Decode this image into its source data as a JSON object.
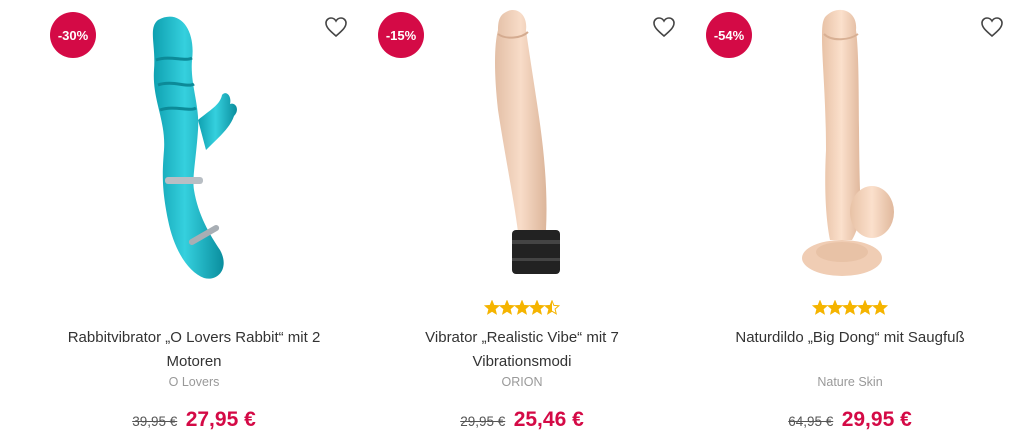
{
  "products": [
    {
      "discount": "-30%",
      "title": "Rabbitvibrator „O Lovers Rabbit“ mit 2 Motoren",
      "brand": "O Lovers",
      "old_price": "39,95 €",
      "new_price": "27,95 €",
      "rating": null,
      "image_color": "#1ab5c4"
    },
    {
      "discount": "-15%",
      "title": "Vibrator „Realistic Vibe“ mit 7 Vibrationsmodi",
      "brand": "ORION",
      "old_price": "29,95 €",
      "new_price": "25,46 €",
      "rating": 4.5,
      "image_color": "#f2d2bc"
    },
    {
      "discount": "-54%",
      "title": "Naturdildo „Big Dong“ mit Saugfuß",
      "brand": "Nature Skin",
      "old_price": "64,95 €",
      "new_price": "29,95 €",
      "rating": 5,
      "image_color": "#f4d4bc"
    }
  ],
  "colors": {
    "badge": "#d40a46",
    "price": "#d40a46",
    "star": "#f5b400"
  },
  "icons": {
    "wishlist": "heart-icon",
    "star": "star-icon"
  }
}
